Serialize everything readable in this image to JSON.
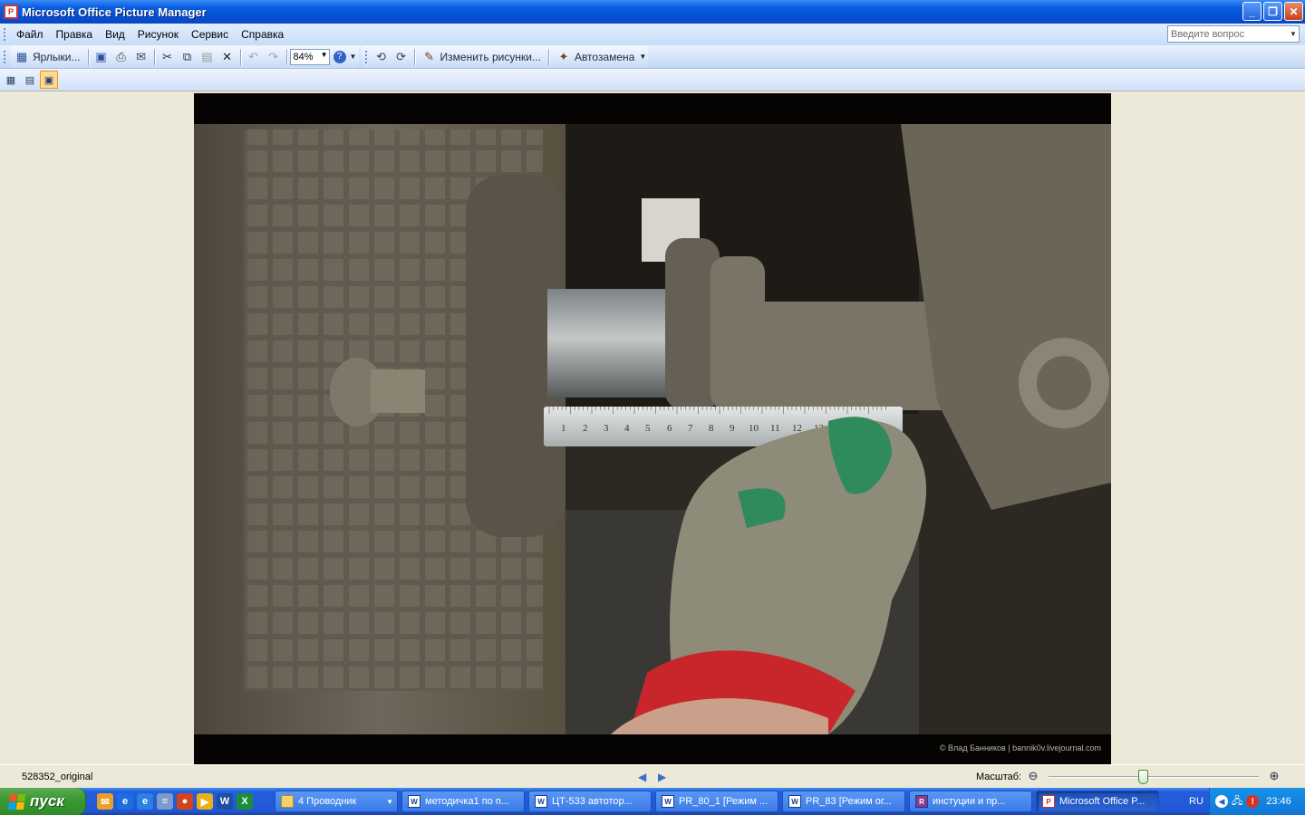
{
  "window": {
    "title": "Microsoft Office Picture Manager"
  },
  "menu": {
    "items": [
      "Файл",
      "Правка",
      "Вид",
      "Рисунок",
      "Сервис",
      "Справка"
    ],
    "ask_placeholder": "Введите вопрос"
  },
  "toolbar": {
    "shortcuts_label": "Ярлыки...",
    "zoom_value": "84%",
    "edit_pictures_label": "Изменить рисунки...",
    "autocorrect_label": "Автозамена"
  },
  "photo": {
    "ruler_numbers": [
      "1",
      "2",
      "3",
      "4",
      "5",
      "6",
      "7",
      "8",
      "9",
      "10",
      "11",
      "12",
      "13"
    ],
    "watermark": "© Влад Банников | bannik0v.livejournal.com"
  },
  "status": {
    "filename": "528352_original",
    "scale_label": "Масштаб:",
    "zoom_level": 0.45
  },
  "taskbar": {
    "start_label": "пуск",
    "tasks": [
      {
        "label": "4 Проводник",
        "icon": "folder-icon",
        "dropdown": true
      },
      {
        "label": "методичка1 по п...",
        "icon": "word-icon"
      },
      {
        "label": "ЦТ-533 автотор...",
        "icon": "word-icon"
      },
      {
        "label": "PR_80_1 [Режим ...",
        "icon": "word-icon"
      },
      {
        "label": "PR_83 [Режим ог...",
        "icon": "word-icon"
      },
      {
        "label": "инстуции и пр...",
        "icon": "winrar-icon"
      },
      {
        "label": "Microsoft Office P...",
        "icon": "picture-manager-icon",
        "active": true
      }
    ],
    "lang": "RU",
    "clock": "23:46"
  },
  "colors": {
    "titlebar": "#0550d6",
    "taskbar": "#2157d6",
    "start": "#3c9a34",
    "tray": "#0f76d6"
  }
}
